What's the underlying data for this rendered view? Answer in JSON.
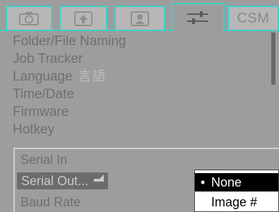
{
  "tabs": [
    {
      "name": "camera-icon",
      "label": ""
    },
    {
      "name": "upload-icon",
      "label": ""
    },
    {
      "name": "portrait-icon",
      "label": ""
    },
    {
      "name": "settings-sliders-icon",
      "label": ""
    },
    {
      "name": "csm",
      "label": "CSM"
    }
  ],
  "active_tab": "settings",
  "menu": {
    "items": [
      {
        "label": "Folder/File Naming"
      },
      {
        "label": "Job Tracker"
      },
      {
        "label": "Language",
        "extra": "言語"
      },
      {
        "label": "Time/Date"
      },
      {
        "label": "Firmware"
      },
      {
        "label": "Hotkey"
      }
    ]
  },
  "submenu": {
    "items": [
      {
        "label": "Serial In"
      },
      {
        "label": "Serial Out..."
      },
      {
        "label": "Baud Rate"
      }
    ],
    "selected": "Serial Out..."
  },
  "popup": {
    "options": [
      {
        "label": "None",
        "bullet": "•"
      },
      {
        "label": "Image #",
        "bullet": ""
      }
    ],
    "selected": "None"
  },
  "colors": {
    "background": "#9d9d9d",
    "tab_border": "#3fd0c8",
    "text": "#6f6f6f",
    "selected_bg": "#6c6c6c",
    "popup_selected_bg": "#000000"
  }
}
